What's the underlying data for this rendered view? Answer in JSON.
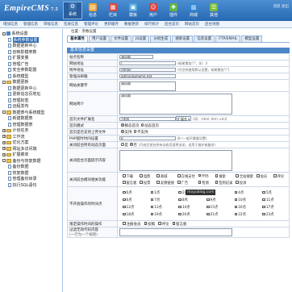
{
  "header": {
    "logo": "EmpireCMS",
    "logo_sub": "7.5",
    "right_links": "消息 退出",
    "nav": [
      {
        "label": "系统",
        "icon": "gear-icon",
        "color": "#3b6fae",
        "active": true
      },
      {
        "label": "信息",
        "icon": "document-icon",
        "color": "#f1a531"
      },
      {
        "label": "栏目",
        "icon": "folder-icon",
        "color": "#e2453c"
      },
      {
        "label": "模板",
        "icon": "template-icon",
        "color": "#52a9e0"
      },
      {
        "label": "用户",
        "icon": "user-icon",
        "color": "#d74242"
      },
      {
        "label": "插件",
        "icon": "plugin-icon",
        "color": "#62b54b"
      },
      {
        "label": "商城",
        "icon": "shop-icon",
        "color": "#2e89d4"
      },
      {
        "label": "其他",
        "icon": "more-icon",
        "color": "#7bbd3b"
      }
    ]
  },
  "subnav": [
    "增加信息",
    "管理信息",
    "审核信息",
    "签发信息",
    "管理评论",
    "更新缓存",
    "数据更新",
    "排行统计",
    "后台首页",
    "网站首页",
    "后台地图"
  ],
  "sidebar": {
    "items": [
      {
        "label": "系统设置",
        "type": "root",
        "level": 0,
        "expander": "-"
      },
      {
        "label": "系统参数设置",
        "type": "doc",
        "level": 1,
        "active": true
      },
      {
        "label": "数据更新中心",
        "type": "doc",
        "level": 1
      },
      {
        "label": "创映影模参数",
        "type": "doc",
        "level": 1
      },
      {
        "label": "扩展变量",
        "type": "doc",
        "level": 1
      },
      {
        "label": "管理广告",
        "type": "doc",
        "level": 1
      },
      {
        "label": "安全参数配置",
        "type": "doc",
        "level": 1
      },
      {
        "label": "系统模型",
        "type": "doc",
        "level": 1
      },
      {
        "label": "数据更新",
        "type": "folder",
        "level": 0,
        "expander": "-"
      },
      {
        "label": "数据更新中心",
        "type": "doc",
        "level": 1
      },
      {
        "label": "更新信息页地址",
        "type": "doc",
        "level": 1
      },
      {
        "label": "管理标签",
        "type": "doc",
        "level": 1
      },
      {
        "label": "远程发布",
        "type": "doc",
        "level": 1
      },
      {
        "label": "数据表与系统模型",
        "type": "folder",
        "level": 0,
        "expander": "-"
      },
      {
        "label": "新建数据表",
        "type": "doc",
        "level": 1
      },
      {
        "label": "管理数据表",
        "type": "doc",
        "level": 1
      },
      {
        "label": "计划任务",
        "type": "folder",
        "level": 0,
        "expander": "+"
      },
      {
        "label": "工作流",
        "type": "folder",
        "level": 0,
        "expander": "+"
      },
      {
        "label": "优化方案",
        "type": "folder",
        "level": 0,
        "expander": "+"
      },
      {
        "label": "网站多访问端",
        "type": "folder",
        "level": 0,
        "expander": "+"
      },
      {
        "label": "扩展菜单",
        "type": "folder",
        "level": 0,
        "expander": "+"
      },
      {
        "label": "备份与恢复数据",
        "type": "folder",
        "level": 0,
        "expander": "-"
      },
      {
        "label": "备份数据",
        "type": "doc",
        "level": 1
      },
      {
        "label": "恢复数据",
        "type": "doc",
        "level": 1
      },
      {
        "label": "管理备份目录",
        "type": "doc",
        "level": 1
      },
      {
        "label": "执行SQL语句",
        "type": "doc",
        "level": 1
      }
    ]
  },
  "main": {
    "breadcrumb": "位置：参数设置",
    "tabs": [
      "基本属性",
      "用户设置",
      "文件设置",
      "JS设置",
      "分组生成",
      "搜索设置",
      "信息设置",
      "FTP/EMAIL",
      "模型设置"
    ],
    "section_title": "基本信息设置",
    "fields": {
      "site_name_label": "站点名称",
      "site_name_value": "清风阁",
      "site_url_label": "网站地址",
      "site_url_value": "/",
      "site_url_hint": "(结尾需加\"/\"，如：/)",
      "attach_url_label": "附件地址",
      "attach_url_value": "/d/file/",
      "attach_url_hint": "(为空则使用默认设置，结尾需加\"/\")",
      "admin_email_label": "管理员邮箱",
      "admin_email_value": "admin@phome.net",
      "keywords_label": "网站关键字",
      "keywords_value": "清风阁",
      "description_label": "网站简介",
      "description_value": "清风阁",
      "index_file_label": "首页文件扩展名",
      "index_file_value": ".html",
      "index_file_select": "扩展名",
      "index_file_hint": "(如：.html,.htm,.xml)",
      "index_mode_label": "首页模式",
      "index_mode_opt1": "静态首页",
      "index_mode_opt2": "动态首页",
      "index_param_label": "首页是否支持上传文件",
      "index_param_opt1": "支持",
      "index_param_opt2": "不支持",
      "php_time_label": "PHP超时时间设置",
      "php_time_value": "0",
      "php_time_hint": "秒 (一般不需要设置)",
      "close_site_label": "关闭前台所有动态页面",
      "close_site_opt1": "是",
      "close_site_opt2": "否",
      "close_site_hint": "(开启后前台所有动态页面将关闭，适用于维护或备份)",
      "close_tip_label": "关闭后台页面提示内容",
      "close_modules_label": "关闭前台模块相关功能",
      "close_modules": [
        "下载",
        "电影",
        "商城",
        "在线支付",
        "RSS",
        "搜索",
        "全站搜索",
        "会员",
        "评论",
        "留言板",
        "投票",
        "友情链接",
        "广告",
        "检测",
        "签到记录",
        "投诉"
      ],
      "week_label": "不开放操作的时间点",
      "week_hours": [
        "0点",
        "1点",
        "2点",
        "3点",
        "4点",
        "5点",
        "6点",
        "7点",
        "8点",
        "9点",
        "10点",
        "11点",
        "12点",
        "13点",
        "14点",
        "15点",
        "16点",
        "17点",
        "18点",
        "19点",
        "20点",
        "21点",
        "22点",
        "23点"
      ],
      "limit_ops_label": "限定操作时间的操作",
      "limit_ops": [
        "注册会员",
        "投稿",
        "评论",
        "留言板"
      ],
      "limit_ops_note": "过滤无效代码内容",
      "limit_ops_note2": "(一行为一个规则)"
    },
    "watermark": "moyublog.com"
  }
}
